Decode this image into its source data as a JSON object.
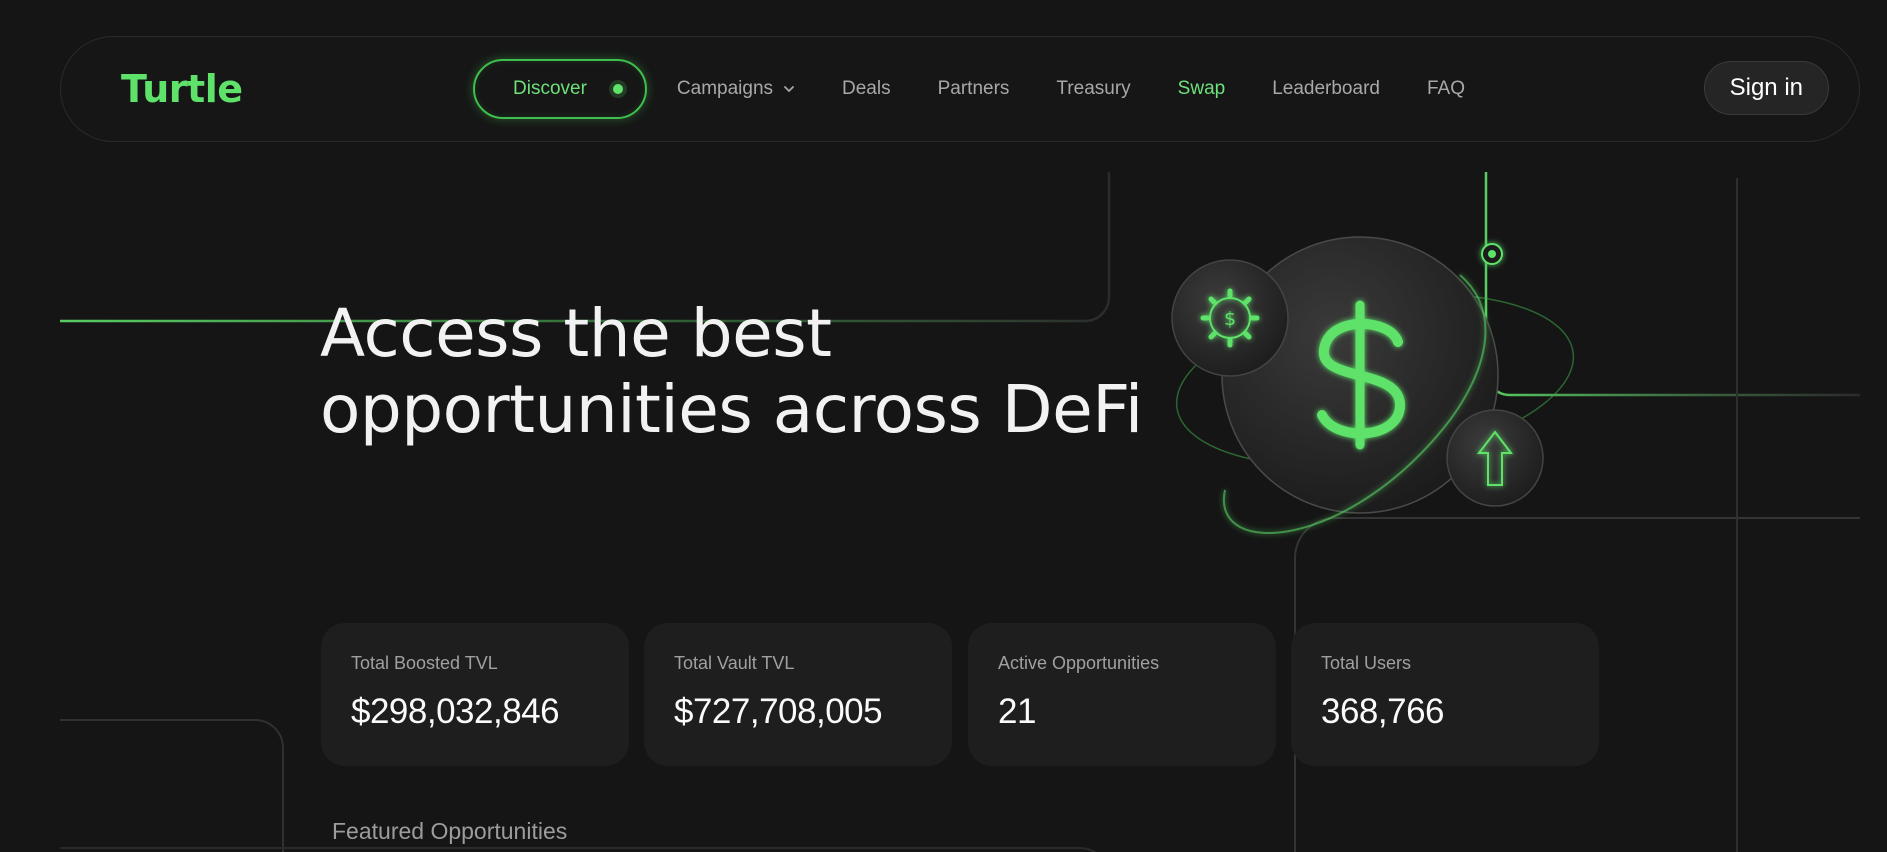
{
  "brand": {
    "logo": "Turtle",
    "accent": "#5ee26a"
  },
  "nav": {
    "items": [
      {
        "label": "Discover",
        "active": true
      },
      {
        "label": "Campaigns",
        "has_dropdown": true
      },
      {
        "label": "Deals"
      },
      {
        "label": "Partners"
      },
      {
        "label": "Treasury"
      },
      {
        "label": "Swap",
        "highlight": true
      },
      {
        "label": "Leaderboard"
      },
      {
        "label": "FAQ"
      }
    ],
    "sign_in": "Sign in"
  },
  "hero": {
    "title_line1": "Access the best",
    "title_line2": "opportunities across DeFi",
    "illustration_icons": [
      "dollar-icon",
      "gear-dollar-icon",
      "arrow-up-icon"
    ]
  },
  "stats": [
    {
      "label": "Total Boosted TVL",
      "value": "$298,032,846"
    },
    {
      "label": "Total Vault TVL",
      "value": "$727,708,005"
    },
    {
      "label": "Active Opportunities",
      "value": "21"
    },
    {
      "label": "Total Users",
      "value": "368,766"
    }
  ],
  "sections": {
    "featured": "Featured Opportunities"
  }
}
